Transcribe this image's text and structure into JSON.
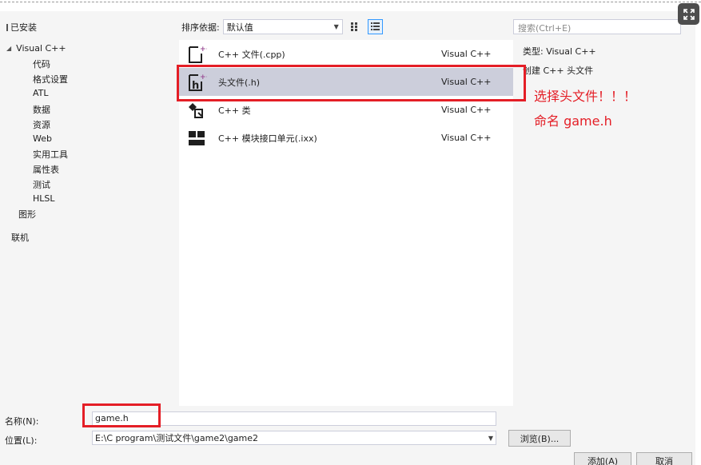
{
  "toolbar": {
    "installed_label": "已安装",
    "sort_label": "排序依据:",
    "sort_value": "默认值",
    "search_placeholder": "搜索(Ctrl+E)"
  },
  "tree": {
    "root_label": "Visual C++",
    "children": [
      "代码",
      "格式设置",
      "ATL",
      "数据",
      "资源",
      "Web",
      "实用工具",
      "属性表",
      "测试",
      "HLSL"
    ],
    "graphics": "图形",
    "online": "联机"
  },
  "templates": [
    {
      "name": "C++ 文件(.cpp)",
      "type": "Visual C++",
      "icon": "cpp-file-icon"
    },
    {
      "name": "头文件(.h)",
      "type": "Visual C++",
      "icon": "header-file-icon",
      "selected": true
    },
    {
      "name": "C++ 类",
      "type": "Visual C++",
      "icon": "class-icon"
    },
    {
      "name": "C++ 模块接口单元(.ixx)",
      "type": "Visual C++",
      "icon": "module-icon"
    }
  ],
  "details": {
    "type_line": "类型: Visual C++",
    "desc_line": "创建 C++ 头文件"
  },
  "annotations": {
    "note1": "选择头文件！！！",
    "note2": "命名   game.h",
    "color": "#e41e26"
  },
  "form": {
    "name_label": "名称(N):",
    "name_value": "game.h",
    "location_label": "位置(L):",
    "location_value": "E:\\C  program\\测试文件\\game2\\game2",
    "browse_label": "浏览(B)...",
    "add_label": "添加(A)",
    "cancel_label": "取消"
  },
  "colors": {
    "dialog_bg": "#f5f5f5",
    "selected_row": "#cccedb",
    "accent": "#68217a"
  }
}
